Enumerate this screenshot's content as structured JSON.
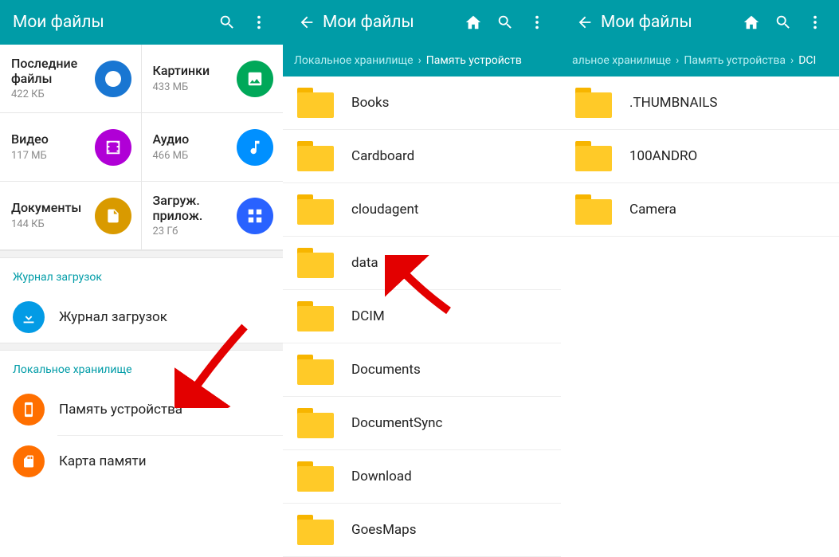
{
  "pane1": {
    "title": "Мои файлы",
    "categories": [
      {
        "label": "Последние файлы",
        "sub": "422 КБ",
        "color": "#1976d2",
        "icon": "clock"
      },
      {
        "label": "Картинки",
        "sub": "433 МБ",
        "color": "#00a859",
        "icon": "image"
      },
      {
        "label": "Видео",
        "sub": "117 МБ",
        "color": "#b000d6",
        "icon": "video"
      },
      {
        "label": "Аудио",
        "sub": "466 МБ",
        "color": "#0090ff",
        "icon": "audio"
      },
      {
        "label": "Документы",
        "sub": "144 КБ",
        "color": "#d99a00",
        "icon": "doc"
      },
      {
        "label": "Загруж. прилож.",
        "sub": "23 Гб",
        "color": "#2962ff",
        "icon": "apps"
      }
    ],
    "section1": "Журнал загрузок",
    "row_downloads": "Журнал загрузок",
    "section2": "Локальное хранилище",
    "row_device": "Память устройства",
    "row_sdcard": "Карта памяти"
  },
  "pane2": {
    "title": "Мои файлы",
    "crumb1": "Локальное хранилище",
    "crumb2": "Память устройств",
    "folders": [
      "Books",
      "Cardboard",
      "cloudagent",
      "data",
      "DCIM",
      "Documents",
      "DocumentSync",
      "Download",
      "GoesMaps"
    ]
  },
  "pane3": {
    "title": "Мои файлы",
    "crumb1": "альное хранилище",
    "crumb2": "Память устройства",
    "crumb3": "DCI",
    "folders": [
      ".THUMBNAILS",
      "100ANDRO",
      "Camera"
    ]
  }
}
